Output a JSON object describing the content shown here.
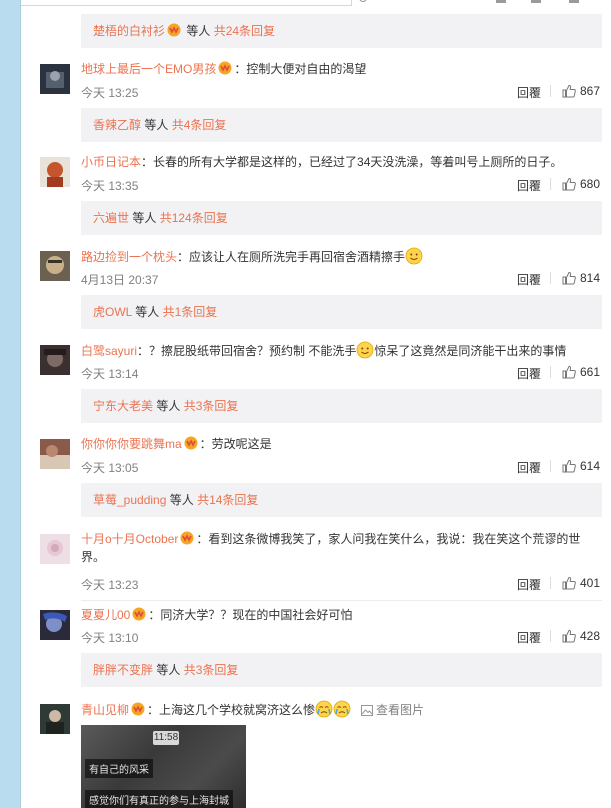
{
  "comments": [
    {
      "username": "地球上最后一个EMO男孩",
      "has_vip": true,
      "text": "：控制大便对自由的渴望",
      "time": "今天 13:25",
      "reply_label": "回覆",
      "likes": "867",
      "subreply": {
        "user": "香辣乙醇",
        "mid": " 等人 ",
        "count": "共4条回复"
      }
    },
    {
      "username": "小币日记本",
      "has_vip": false,
      "text": "：长春的所有大学都是这样的，已经过了34天没洗澡，等着叫号上厕所的日子。",
      "time": "今天 13:35",
      "reply_label": "回覆",
      "likes": "680",
      "subreply": {
        "user": "六遍世",
        "mid": " 等人 ",
        "count": "共124条回复"
      }
    },
    {
      "username": "路边捡到一个枕头",
      "has_vip": false,
      "text": "：应该让人在厕所洗完手再回宿舍酒精擦手",
      "time": "4月13日 20:37",
      "reply_label": "回覆",
      "likes": "814",
      "subreply": {
        "user": "虎OWL",
        "mid": " 等人 ",
        "count": "共1条回复"
      }
    },
    {
      "username": "白鹭sayuri",
      "has_vip": false,
      "text_a": "：？擦屁股纸带回宿舍？预约制 不能洗手",
      "text_b": "惊呆了这竟然是同济能干出来的事情",
      "time": "今天 13:14",
      "reply_label": "回覆",
      "likes": "661",
      "subreply": {
        "user": "宁东大老美",
        "mid": " 等人 ",
        "count": "共3条回复"
      }
    },
    {
      "username": "你你你你要跳舞ma",
      "has_vip": true,
      "text": "：劳改呢这是",
      "time": "今天 13:05",
      "reply_label": "回覆",
      "likes": "614",
      "subreply": {
        "user": "草莓_pudding",
        "mid": " 等人 ",
        "count": "共14条回复"
      }
    },
    {
      "username": "十月o十月October",
      "has_vip": true,
      "text_a": "：看到这条微博我笑了，家人问我在笑什么，我说：我在笑这个荒谬的世",
      "text_b": "界。",
      "time": "今天 13:23",
      "reply_label": "回覆",
      "likes": "401"
    },
    {
      "username": "夏夏儿00",
      "has_vip": true,
      "text": "：同济大学？？现在的中国社会好可怕",
      "time": "今天 13:10",
      "reply_label": "回覆",
      "likes": "428",
      "subreply": {
        "user": "胖胖不变胖",
        "mid": " 等人 ",
        "count": "共3条回复"
      }
    },
    {
      "username": "青山见柳",
      "has_vip": true,
      "text": "：上海这几个学校就窝济这么惨",
      "view_pic": "查看图片"
    }
  ],
  "top_subreply": {
    "user": "楚梧的白衬衫",
    "mid": " 等人 ",
    "count": "共24条回复"
  },
  "thumbnail": {
    "time": "11:58",
    "caption1": "有自己的风采",
    "caption2": "感觉你们有真正的参与上海封城"
  },
  "colors": {
    "username": "#eb7350",
    "subbox_bg": "#f2f2f5",
    "left_strip": "#b9dcef"
  }
}
